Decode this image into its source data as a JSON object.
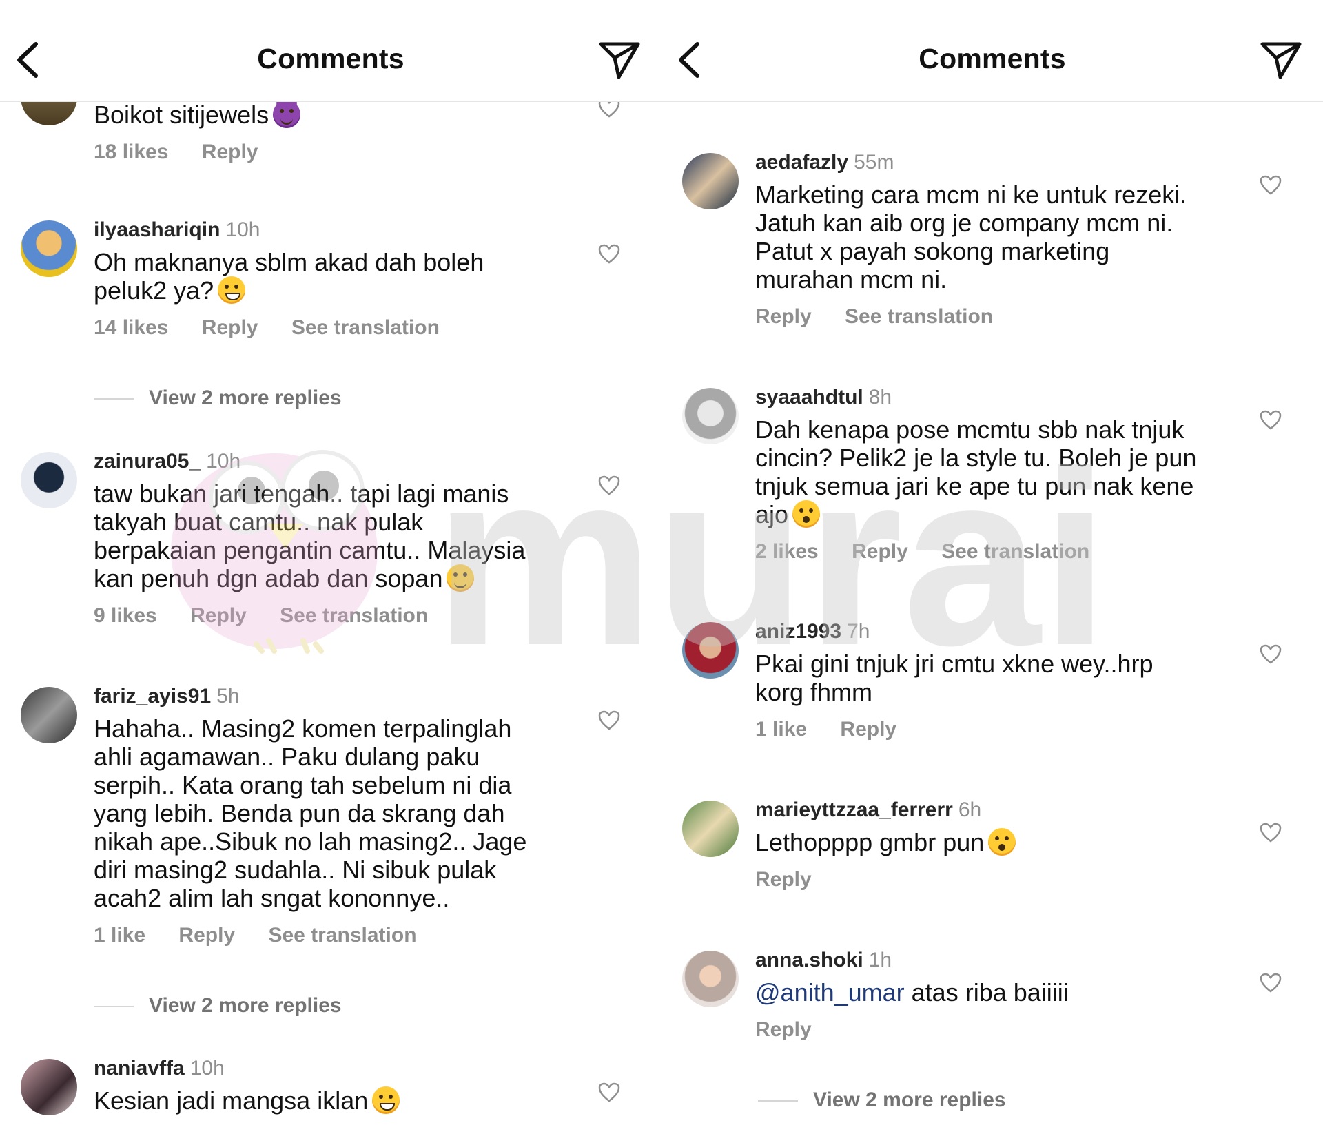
{
  "left": {
    "header": {
      "title": "Comments"
    },
    "comments": [
      {
        "username": "",
        "time": "",
        "text": "Boikot sitijewels",
        "likes": "18 likes",
        "reply": "Reply",
        "translation": ""
      },
      {
        "username": "ilyaashariqin",
        "time": "10h",
        "text_line1": "Oh maknanya sblm akad dah boleh",
        "text_line2": "peluk2 ya?",
        "likes": "14 likes",
        "reply": "Reply",
        "translation": "See translation"
      },
      {
        "username": "zainura05_",
        "time": "10h",
        "text_line1": "taw bukan jari tengah.. tapi lagi manis",
        "text_line2": "takyah buat camtu.. nak pulak",
        "text_line3": "berpakaian pengantin camtu.. Malaysia",
        "text_line4": "kan penuh dgn adab dan sopan",
        "likes": "9 likes",
        "reply": "Reply",
        "translation": "See translation"
      },
      {
        "username": "fariz_ayis91",
        "time": "5h",
        "text_line1": "Hahaha.. Masing2 komen terpalinglah",
        "text_line2": "ahli agamawan.. Paku dulang paku",
        "text_line3": "serpih.. Kata orang tah sebelum ni dia",
        "text_line4": "yang lebih. Benda pun da skrang dah",
        "text_line5": "nikah ape..Sibuk no lah masing2.. Jage",
        "text_line6": "diri masing2 sudahla.. Ni sibuk pulak",
        "text_line7": "acah2 alim lah sngat kononnye..",
        "likes": "1 like",
        "reply": "Reply",
        "translation": "See translation"
      },
      {
        "username": "naniavffa",
        "time": "10h",
        "text": "Kesian jadi mangsa iklan"
      }
    ],
    "view_replies_1": "View 2 more replies",
    "view_replies_2": "View 2 more replies"
  },
  "right": {
    "header": {
      "title": "Comments"
    },
    "comments": [
      {
        "username": "aedafazly",
        "time": "55m",
        "text_line1": "Marketing cara mcm ni ke untuk rezeki.",
        "text_line2": "Jatuh kan aib org je company mcm ni.",
        "text_line3": "Patut x payah sokong marketing",
        "text_line4": "murahan mcm ni.",
        "reply": "Reply",
        "translation": "See translation"
      },
      {
        "username": "syaaahdtul",
        "time": "8h",
        "text_line1": "Dah kenapa pose mcmtu sbb nak tnjuk",
        "text_line2": "cincin? Pelik2 je la style tu. Boleh je pun",
        "text_line3": "tnjuk semua jari ke ape tu pun nak kene",
        "text_line4": "ajo",
        "likes": "2 likes",
        "reply": "Reply",
        "translation": "See translation"
      },
      {
        "username": "aniz1993",
        "time": "7h",
        "text_line1": "Pkai gini tnjuk jri cmtu xkne wey..hrp",
        "text_line2": "korg fhmm",
        "likes": "1 like",
        "reply": "Reply"
      },
      {
        "username": "marieyttzzaa_ferrerr",
        "time": "6h",
        "text": "Lethopppp gmbr pun",
        "reply": "Reply"
      },
      {
        "username": "anna.shoki",
        "time": "1h",
        "mention": "@anith_umar",
        "text": " atas riba baiiiii",
        "reply": "Reply"
      }
    ],
    "view_replies": "View 2 more replies"
  },
  "watermark": {
    "text": "murai"
  },
  "colors": {
    "meta_gray": "#8e8e8e",
    "mention_blue": "#1e3a78",
    "divider": "#e6e6e6"
  },
  "icons": {
    "back": "chevron-left-icon",
    "send": "paper-plane-icon",
    "like": "heart-icon"
  }
}
